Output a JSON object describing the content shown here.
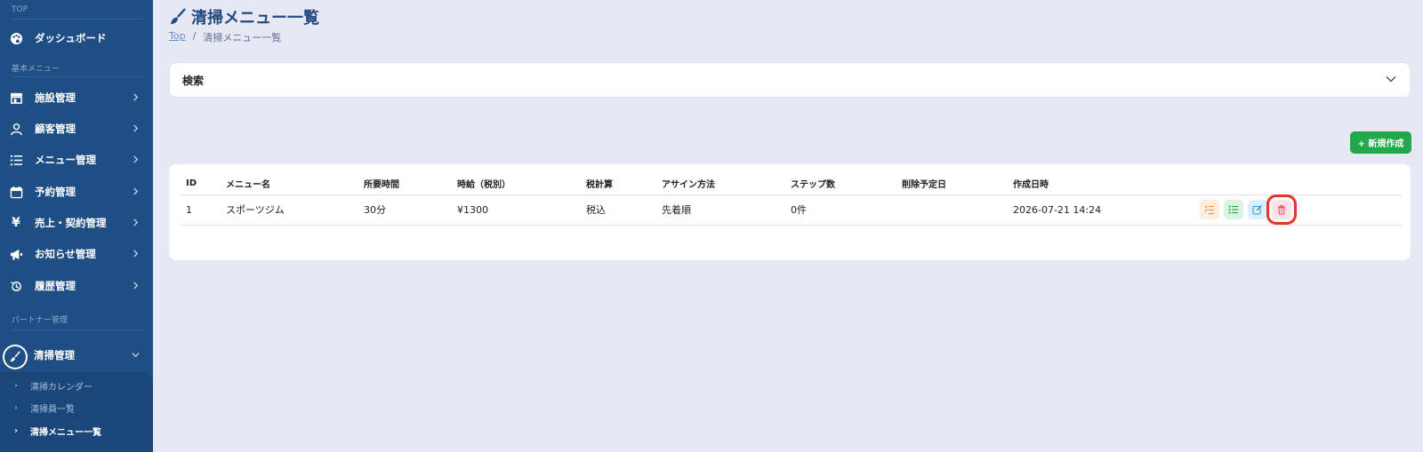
{
  "sidebar": {
    "sections": {
      "top": "TOP",
      "basic": "基本メニュー",
      "partner": "パートナー管理"
    },
    "items": [
      {
        "label": "ダッシュボード",
        "icon": "palette-icon"
      },
      {
        "label": "施設管理",
        "icon": "store-icon"
      },
      {
        "label": "顧客管理",
        "icon": "user-icon"
      },
      {
        "label": "メニュー管理",
        "icon": "list-icon"
      },
      {
        "label": "予約管理",
        "icon": "calendar-icon"
      },
      {
        "label": "売上・契約管理",
        "icon": "yen-icon"
      },
      {
        "label": "お知らせ管理",
        "icon": "megaphone-icon"
      },
      {
        "label": "履歴管理",
        "icon": "history-icon"
      }
    ],
    "active": {
      "label": "清掃管理",
      "icon": "broom-icon"
    },
    "subitems": [
      {
        "label": "清掃カレンダー"
      },
      {
        "label": "清掃員一覧"
      },
      {
        "label": "清掃メニュー一覧"
      }
    ]
  },
  "page": {
    "title": "清掃メニュー一覧",
    "breadcrumb": {
      "home": "Top",
      "sep": "/",
      "current": "清掃メニュー一覧"
    }
  },
  "search": {
    "label": "検索"
  },
  "new_button": "+ 新規作成",
  "table": {
    "headers": [
      "ID",
      "メニュー名",
      "所要時間",
      "時給（税別）",
      "税計算",
      "アサイン方法",
      "ステップ数",
      "削除予定日",
      "作成日時"
    ],
    "rows": [
      {
        "id": "1",
        "name": "スポーツジム",
        "duration": "30分",
        "wage": "¥1300",
        "tax": "税込",
        "assign": "先着順",
        "steps": "0件",
        "delete_date": "",
        "created": "2026-07-21 14:24"
      }
    ]
  },
  "colors": {
    "sidebar": "#1f4e85",
    "background": "#e6e9f4",
    "accent_green": "#22a84a",
    "highlight": "#e8332a"
  }
}
